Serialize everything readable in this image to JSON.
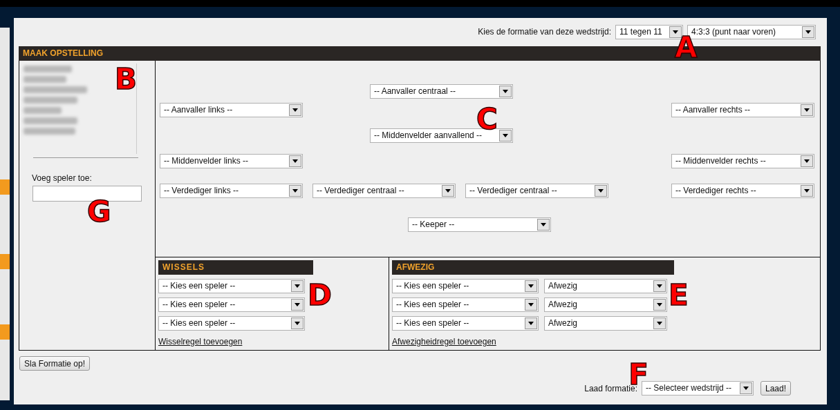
{
  "formation_bar": {
    "label": "Kies de formatie van deze wedstrijd:",
    "team_size": "11 tegen 11",
    "formation": "4:3:3 (punt naar voren)",
    "marker": "A"
  },
  "lineup": {
    "title": "MAAK OPSTELLING",
    "player_marker": "B",
    "add_player": {
      "label": "Voeg speler toe:",
      "marker": "G"
    },
    "pitch_marker": "C",
    "positions": [
      [
        "-- Aanvaller centraal --"
      ],
      [
        "-- Aanvaller links --",
        "-- Aanvaller rechts --"
      ],
      [
        "-- Middenvelder aanvallend --"
      ],
      [
        "-- Middenvelder links --",
        "-- Middenvelder rechts --"
      ],
      [
        "-- Verdediger links --",
        "-- Verdediger centraal --",
        "-- Verdediger centraal --",
        "-- Verdediger rechts --"
      ],
      [
        "-- Keeper --"
      ]
    ]
  },
  "substitutes": {
    "title": "WISSELS",
    "marker": "D",
    "rows": [
      "-- Kies een speler --",
      "-- Kies een speler --",
      "-- Kies een speler --"
    ],
    "add_link": "Wisselregel toevoegen"
  },
  "absences": {
    "title": "AFWEZIG",
    "marker": "E",
    "rows": [
      {
        "player": "-- Kies een speler --",
        "reason": "Afwezig"
      },
      {
        "player": "-- Kies een speler --",
        "reason": "Afwezig"
      },
      {
        "player": "-- Kies een speler --",
        "reason": "Afwezig"
      }
    ],
    "add_link": "Afwezigheidregel toevoegen"
  },
  "save_button": "Sla Formatie op!",
  "load_bar": {
    "label": "Laad formatie:",
    "match": "-- Selecteer wedstrijd --",
    "button": "Laad!",
    "marker": "F"
  }
}
